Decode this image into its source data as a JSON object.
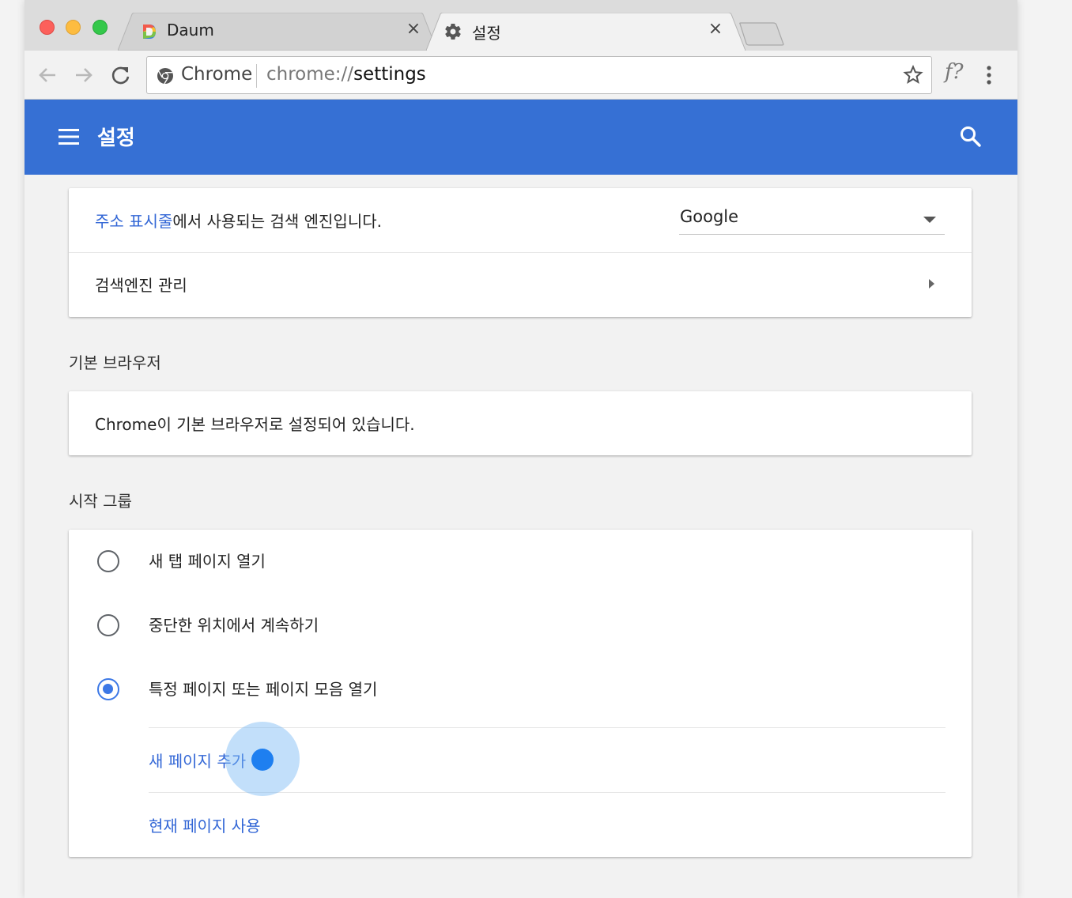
{
  "tabs": [
    {
      "title": "Daum",
      "favicon": "daum-logo-icon",
      "close": "×"
    },
    {
      "title": "설정",
      "favicon": "gear-icon",
      "close": "×"
    }
  ],
  "toolbar": {
    "omnibox_chip": "Chrome",
    "url_scheme": "chrome://",
    "url_host": "settings",
    "extension_label": "f?"
  },
  "header": {
    "title": "설정",
    "menu_icon": "hamburger-icon",
    "search_icon": "search-icon"
  },
  "search_card": {
    "description_link": "주소 표시줄",
    "description_rest": "에서 사용되는 검색 엔진입니다.",
    "selected_engine": "Google",
    "manage_label": "검색엔진 관리"
  },
  "default_browser": {
    "section_label": "기본 브라우저",
    "status_text": "Chrome이 기본 브라우저로 설정되어 있습니다."
  },
  "startup": {
    "section_label": "시작 그룹",
    "options": [
      {
        "label": "새 탭 페이지 열기",
        "checked": false
      },
      {
        "label": "중단한 위치에서 계속하기",
        "checked": false
      },
      {
        "label": "특정 페이지 또는 페이지 모음 열기",
        "checked": true
      }
    ],
    "add_page_link": "새 페이지 추가",
    "use_current_link": "현재 페이지 사용"
  },
  "colors": {
    "header_blue": "#3670d4",
    "link_blue": "#3367d6",
    "radio_blue": "#3c78e6"
  }
}
